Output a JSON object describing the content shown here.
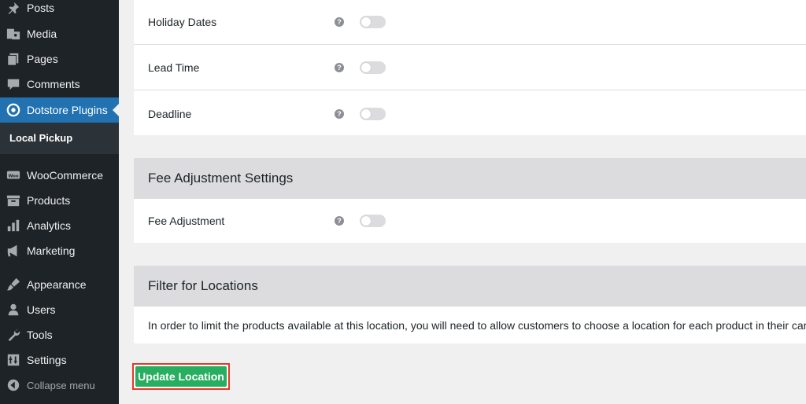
{
  "sidebar": {
    "items": [
      {
        "label": "Posts",
        "icon": "pin-icon"
      },
      {
        "label": "Media",
        "icon": "media-icon"
      },
      {
        "label": "Pages",
        "icon": "pages-icon"
      },
      {
        "label": "Comments",
        "icon": "comments-icon"
      },
      {
        "label": "Dotstore Plugins",
        "icon": "dotstore-icon"
      },
      {
        "label": "WooCommerce",
        "icon": "woocommerce-icon"
      },
      {
        "label": "Products",
        "icon": "products-icon"
      },
      {
        "label": "Analytics",
        "icon": "analytics-icon"
      },
      {
        "label": "Marketing",
        "icon": "megaphone-icon"
      },
      {
        "label": "Appearance",
        "icon": "brush-icon"
      },
      {
        "label": "Users",
        "icon": "users-icon"
      },
      {
        "label": "Tools",
        "icon": "wrench-icon"
      },
      {
        "label": "Settings",
        "icon": "settings-icon"
      }
    ],
    "submenu_active": "Local Pickup",
    "collapse_label": "Collapse menu",
    "active_color": "#2271b1"
  },
  "general": {
    "rows": [
      {
        "label": "Holiday Dates",
        "enabled": false
      },
      {
        "label": "Lead Time",
        "enabled": false
      },
      {
        "label": "Deadline",
        "enabled": false
      }
    ]
  },
  "fee_section": {
    "title": "Fee Adjustment Settings",
    "rows": [
      {
        "label": "Fee Adjustment",
        "enabled": false
      }
    ]
  },
  "filter_section": {
    "title": "Filter for Locations",
    "description": "In order to limit the products available at this location, you will need to allow customers to choose a location for each product in their cart."
  },
  "help_glyph": "?",
  "update_button": {
    "label": "Update Location",
    "color": "#27ae60"
  }
}
